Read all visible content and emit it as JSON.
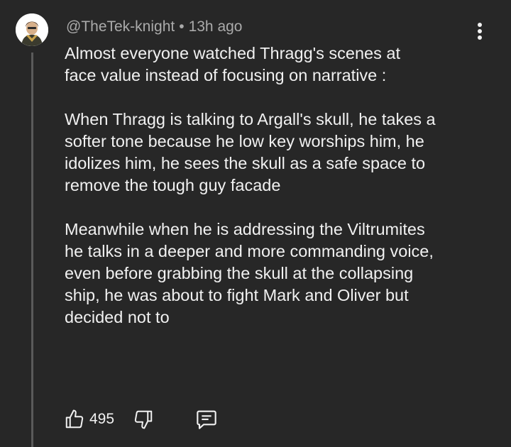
{
  "comment": {
    "author": "@TheTek-knight",
    "separator": "•",
    "timestamp": "13h ago",
    "lines": [
      "Almost everyone watched Thragg's scenes at",
      "face value instead of focusing on narrative :",
      "",
      "When Thragg is talking to Argall's skull, he takes a",
      "softer tone because he low key worships him, he",
      "idolizes him, he sees the skull as a safe space to",
      "remove the tough guy facade",
      "",
      "Meanwhile when he is addressing the Viltrumites",
      "he talks in a deeper and more commanding voice,",
      "even before grabbing the skull at the collapsing",
      "ship, he was about to fight Mark and Oliver but",
      "decided not to"
    ],
    "like_count": "495"
  },
  "icons": {
    "avatar": "user-avatar-image",
    "more": "more-vertical-icon",
    "like": "thumbs-up-icon",
    "dislike": "thumbs-down-icon",
    "reply": "reply-comment-icon"
  },
  "colors": {
    "background": "#272727",
    "text": "#f1f1f1",
    "secondary_text": "#aaaaaa",
    "thread_line": "#5a5a5a"
  }
}
